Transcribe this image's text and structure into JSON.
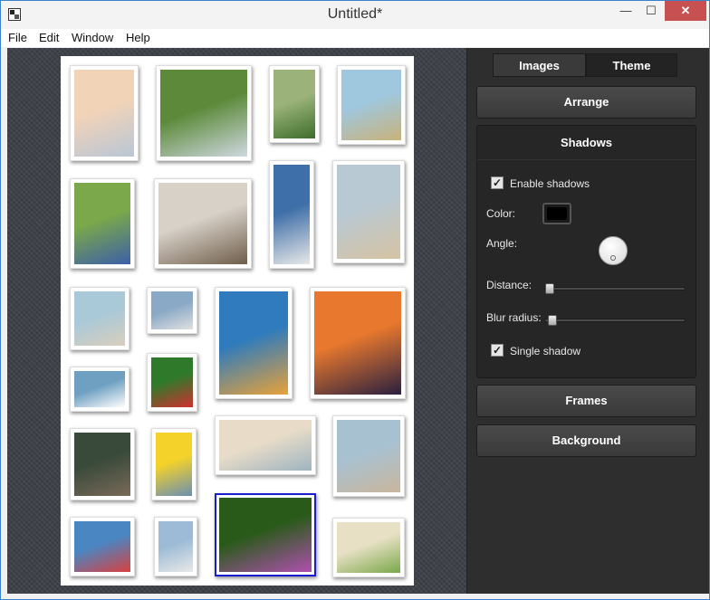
{
  "window": {
    "title": "Untitled*",
    "minimize_glyph": "—",
    "maximize_glyph": "☐",
    "close_glyph": "✕"
  },
  "menu": {
    "items": [
      "File",
      "Edit",
      "Window",
      "Help"
    ]
  },
  "sidebar": {
    "tabs": [
      {
        "label": "Images",
        "selected": false
      },
      {
        "label": "Theme",
        "selected": true
      }
    ],
    "sections": {
      "arrange": "Arrange",
      "shadows": "Shadows",
      "frames": "Frames",
      "background": "Background"
    },
    "shadows": {
      "enable_shadows_label": "Enable shadows",
      "enable_shadows_checked": true,
      "color_label": "Color:",
      "color_value": "#000000",
      "angle_label": "Angle:",
      "distance_label": "Distance:",
      "distance_level": 0.0,
      "blur_label": "Blur radius:",
      "blur_level": 0.02,
      "single_shadow_label": "Single shadow",
      "single_shadow_checked": true
    }
  },
  "photos": [
    {
      "subject": "baby-portrait",
      "colors": [
        "#f1d3b8",
        "#b9c6d6"
      ]
    },
    {
      "subject": "lighthouse-fence",
      "colors": [
        "#5c8a3a",
        "#cfd8e0"
      ]
    },
    {
      "subject": "child-on-bike",
      "colors": [
        "#9bb37a",
        "#3d6e2a"
      ]
    },
    {
      "subject": "pier-ocean",
      "colors": [
        "#9fc7de",
        "#c9b27b"
      ]
    },
    {
      "subject": "colorful-bird",
      "colors": [
        "#7aa84a",
        "#3c5fa8"
      ]
    },
    {
      "subject": "sloppy-joes-bar",
      "colors": [
        "#d7d1c8",
        "#6f5d4a"
      ]
    },
    {
      "subject": "white-lighthouse",
      "colors": [
        "#3f6fa8",
        "#e8e8e8"
      ]
    },
    {
      "subject": "boy-on-beach",
      "colors": [
        "#b9c9d3",
        "#d6c3a3"
      ]
    },
    {
      "subject": "surfer-kid",
      "colors": [
        "#a9c8d8",
        "#d9cfbd"
      ]
    },
    {
      "subject": "marina-boats",
      "colors": [
        "#8aa9c6",
        "#e0e0e0"
      ]
    },
    {
      "subject": "parrots",
      "colors": [
        "#2f7bbd",
        "#e8a23a"
      ]
    },
    {
      "subject": "sunset-ship",
      "colors": [
        "#e8782d",
        "#2a2040"
      ]
    },
    {
      "subject": "speedboat",
      "colors": [
        "#6fa0c2",
        "#ffffff"
      ]
    },
    {
      "subject": "red-butterfly",
      "colors": [
        "#2f7a2a",
        "#d03030"
      ]
    },
    {
      "subject": "beach-shore",
      "colors": [
        "#e8dcc8",
        "#9fb4c0"
      ]
    },
    {
      "subject": "baby-on-sand",
      "colors": [
        "#a8c1d1",
        "#c9b69c"
      ]
    },
    {
      "subject": "jet-ski",
      "colors": [
        "#3a4a3a",
        "#7a6a5a"
      ]
    },
    {
      "subject": "kid-fishing",
      "colors": [
        "#f5d22a",
        "#6a8fb2"
      ]
    },
    {
      "subject": "striped-lighthouse",
      "colors": [
        "#4a86c2",
        "#d84040"
      ]
    },
    {
      "subject": "harbor-masts",
      "colors": [
        "#9dbbd6",
        "#e8e8e8"
      ]
    },
    {
      "subject": "purple-orchids",
      "colors": [
        "#2a5a1a",
        "#b050b0"
      ]
    },
    {
      "subject": "yellow-butterfly",
      "colors": [
        "#e7e0c4",
        "#7aa84a"
      ]
    }
  ]
}
